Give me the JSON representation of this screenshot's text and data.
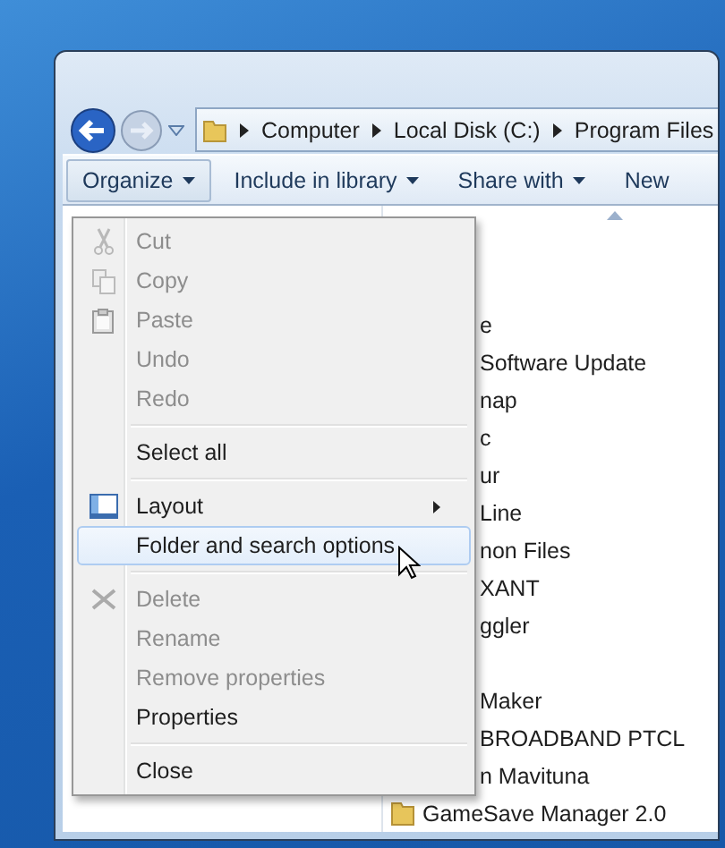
{
  "address": {
    "segments": [
      "Computer",
      "Local Disk (C:)",
      "Program Files"
    ]
  },
  "toolbar": [
    {
      "label": "Organize",
      "selected": true
    },
    {
      "label": "Include in library",
      "selected": false
    },
    {
      "label": "Share with",
      "selected": false
    },
    {
      "label": "New",
      "selected": false
    }
  ],
  "menu": [
    {
      "kind": "cut",
      "label": "Cut",
      "disabled": true,
      "selected": false
    },
    {
      "kind": "copy",
      "label": "Copy",
      "disabled": true,
      "selected": false
    },
    {
      "kind": "paste",
      "label": "Paste",
      "disabled": true,
      "selected": false
    },
    {
      "kind": "item",
      "label": "Undo",
      "disabled": true,
      "selected": false
    },
    {
      "kind": "item",
      "label": "Redo",
      "disabled": true,
      "selected": false
    },
    {
      "kind": "separator"
    },
    {
      "kind": "item",
      "label": "Select all",
      "disabled": false,
      "selected": false
    },
    {
      "kind": "separator"
    },
    {
      "kind": "layout",
      "label": "Layout",
      "submenu": true,
      "disabled": false,
      "selected": false
    },
    {
      "kind": "item",
      "label": "Folder and search options",
      "disabled": false,
      "selected": true
    },
    {
      "kind": "separator"
    },
    {
      "kind": "delete",
      "label": "Delete",
      "disabled": true,
      "selected": false
    },
    {
      "kind": "item",
      "label": "Rename",
      "disabled": true,
      "selected": false
    },
    {
      "kind": "item",
      "label": "Remove properties",
      "disabled": true,
      "selected": false
    },
    {
      "kind": "item",
      "label": "Properties",
      "disabled": false,
      "selected": false
    },
    {
      "kind": "separator"
    },
    {
      "kind": "item",
      "label": "Close",
      "disabled": false,
      "selected": false
    }
  ],
  "files": [
    {
      "kind": "fragment",
      "name": "e"
    },
    {
      "kind": "fragment",
      "name": "Software Update"
    },
    {
      "kind": "fragment",
      "name": "nap"
    },
    {
      "kind": "fragment",
      "name": "c"
    },
    {
      "kind": "fragment",
      "name": "ur"
    },
    {
      "kind": "fragment",
      "name": "Line"
    },
    {
      "kind": "fragment",
      "name": "non Files"
    },
    {
      "kind": "fragment",
      "name": "XANT"
    },
    {
      "kind": "fragment",
      "name": "ggler"
    },
    {
      "kind": "blank"
    },
    {
      "kind": "fragment",
      "name": "Maker"
    },
    {
      "kind": "fragment",
      "name": "BROADBAND PTCL"
    },
    {
      "kind": "fragment",
      "name": "n Mavituna"
    },
    {
      "kind": "folder",
      "name": "GameSave Manager 2.0"
    }
  ]
}
